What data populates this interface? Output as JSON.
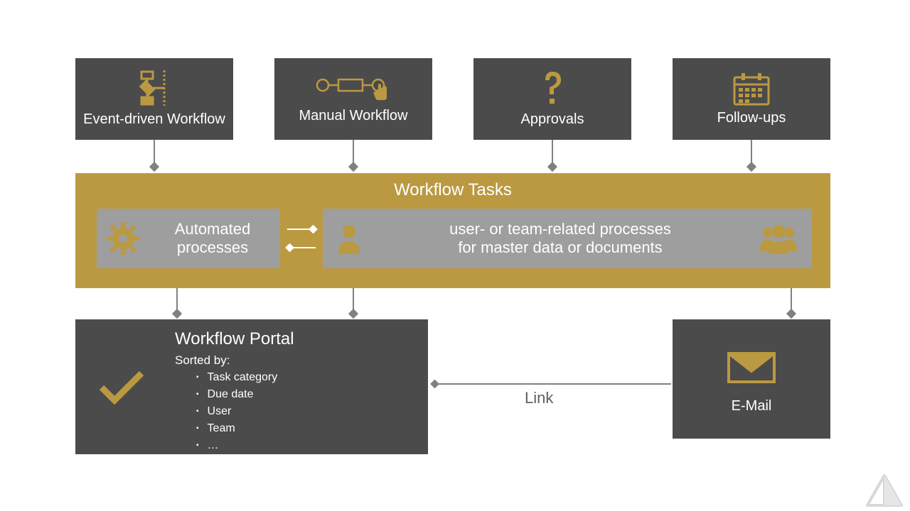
{
  "top": {
    "event": "Event-driven Workflow",
    "manual": "Manual Workflow",
    "approvals": "Approvals",
    "followups": "Follow-ups"
  },
  "tasks": {
    "title": "Workflow Tasks",
    "automated_l1": "Automated",
    "automated_l2": "processes",
    "user_l1": "user- or team-related processes",
    "user_l2": "for master data or documents"
  },
  "portal": {
    "title": "Workflow Portal",
    "sorted_by": "Sorted by:",
    "items": [
      "Task category",
      "Due date",
      "User",
      "Team",
      "…"
    ]
  },
  "email": {
    "title": "E-Mail",
    "link": "Link"
  }
}
